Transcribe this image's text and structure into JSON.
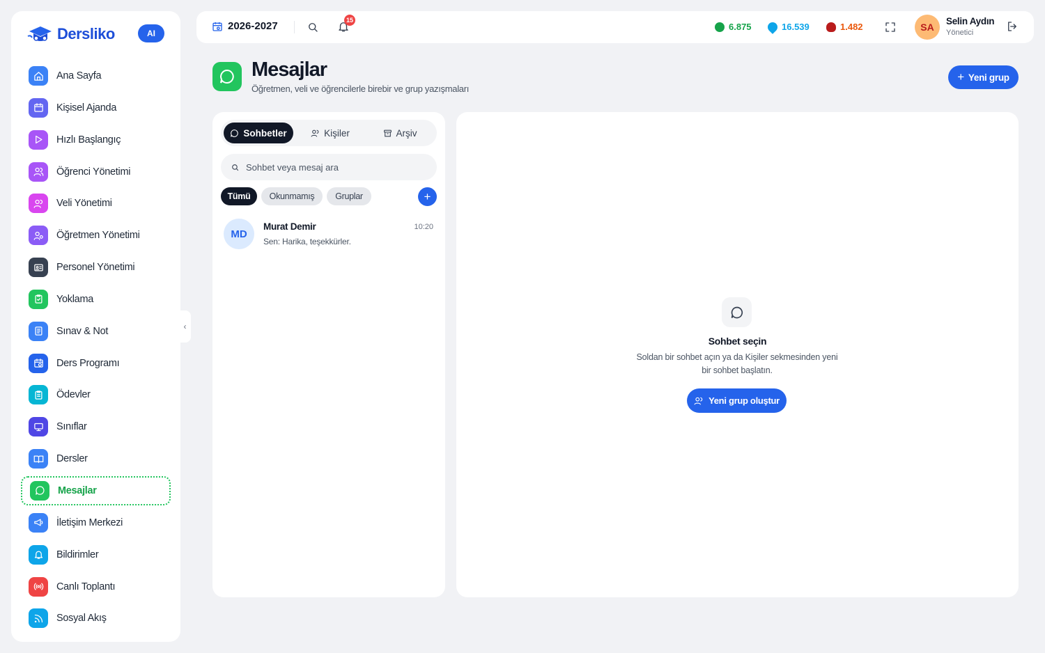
{
  "brand": {
    "name": "Dersliko",
    "ai_badge": "AI"
  },
  "sidebar": {
    "items": [
      {
        "label": "Ana Sayfa",
        "icon": "home-icon",
        "color": "#3b82f6"
      },
      {
        "label": "Kişisel Ajanda",
        "icon": "calendar-icon",
        "color": "#6366f1"
      },
      {
        "label": "Hızlı Başlangıç",
        "icon": "play-icon",
        "color": "#a855f7"
      },
      {
        "label": "Öğrenci Yönetimi",
        "icon": "users-icon",
        "color": "#a855f7"
      },
      {
        "label": "Veli Yönetimi",
        "icon": "users-icon",
        "color": "#d946ef"
      },
      {
        "label": "Öğretmen Yönetimi",
        "icon": "teacher-icon",
        "color": "#8b5cf6"
      },
      {
        "label": "Personel Yönetimi",
        "icon": "id-card-icon",
        "color": "#374151"
      },
      {
        "label": "Yoklama",
        "icon": "clipboard-check-icon",
        "color": "#22c55e"
      },
      {
        "label": "Sınav & Not",
        "icon": "exam-icon",
        "color": "#3b82f6"
      },
      {
        "label": "Ders Programı",
        "icon": "schedule-icon",
        "color": "#2563eb"
      },
      {
        "label": "Ödevler",
        "icon": "homework-icon",
        "color": "#06b6d4"
      },
      {
        "label": "Sınıflar",
        "icon": "classroom-icon",
        "color": "#4f46e5"
      },
      {
        "label": "Dersler",
        "icon": "book-icon",
        "color": "#3b82f6"
      },
      {
        "label": "Mesajlar",
        "icon": "chat-icon",
        "color": "#22c55e"
      },
      {
        "label": "İletişim Merkezi",
        "icon": "megaphone-icon",
        "color": "#3b82f6"
      },
      {
        "label": "Bildirimler",
        "icon": "bell-icon",
        "color": "#0ea5e9"
      },
      {
        "label": "Canlı Toplantı",
        "icon": "broadcast-icon",
        "color": "#ef4444"
      },
      {
        "label": "Sosyal Akış",
        "icon": "rss-icon",
        "color": "#0ea5e9"
      }
    ],
    "active_label": "Mesajlar"
  },
  "topbar": {
    "year": "2026-2027",
    "notifications_count": "15",
    "stats": [
      {
        "value": "6.875",
        "color": "#16a34a",
        "icon": "green-gem-icon"
      },
      {
        "value": "16.539",
        "color": "#0ea5e9",
        "icon": "blue-gem-icon"
      },
      {
        "value": "1.482",
        "color": "#ea580c",
        "icon": "red-gem-icon"
      }
    ],
    "user": {
      "initials": "SA",
      "name": "Selin Aydın",
      "role": "Yönetici"
    }
  },
  "page": {
    "title": "Mesajlar",
    "subtitle": "Öğretmen, veli ve öğrencilerle birebir ve grup yazışmaları",
    "new_group_label": "Yeni grup"
  },
  "chat_list": {
    "tabs": [
      {
        "label": "Sohbetler",
        "icon": "chat-icon"
      },
      {
        "label": "Kişiler",
        "icon": "users-icon"
      },
      {
        "label": "Arşiv",
        "icon": "archive-icon"
      }
    ],
    "search_placeholder": "Sohbet veya mesaj ara",
    "filters": [
      "Tümü",
      "Okunmamış",
      "Gruplar"
    ],
    "conversations": [
      {
        "initials": "MD",
        "name": "Murat Demir",
        "time": "10:20",
        "last_message": "Sen: Harika, teşekkürler."
      }
    ]
  },
  "empty_state": {
    "title": "Sohbet seçin",
    "description": "Soldan bir sohbet açın ya da Kişiler sekmesinden yeni bir sohbet başlatın.",
    "button_label": "Yeni grup oluştur"
  }
}
